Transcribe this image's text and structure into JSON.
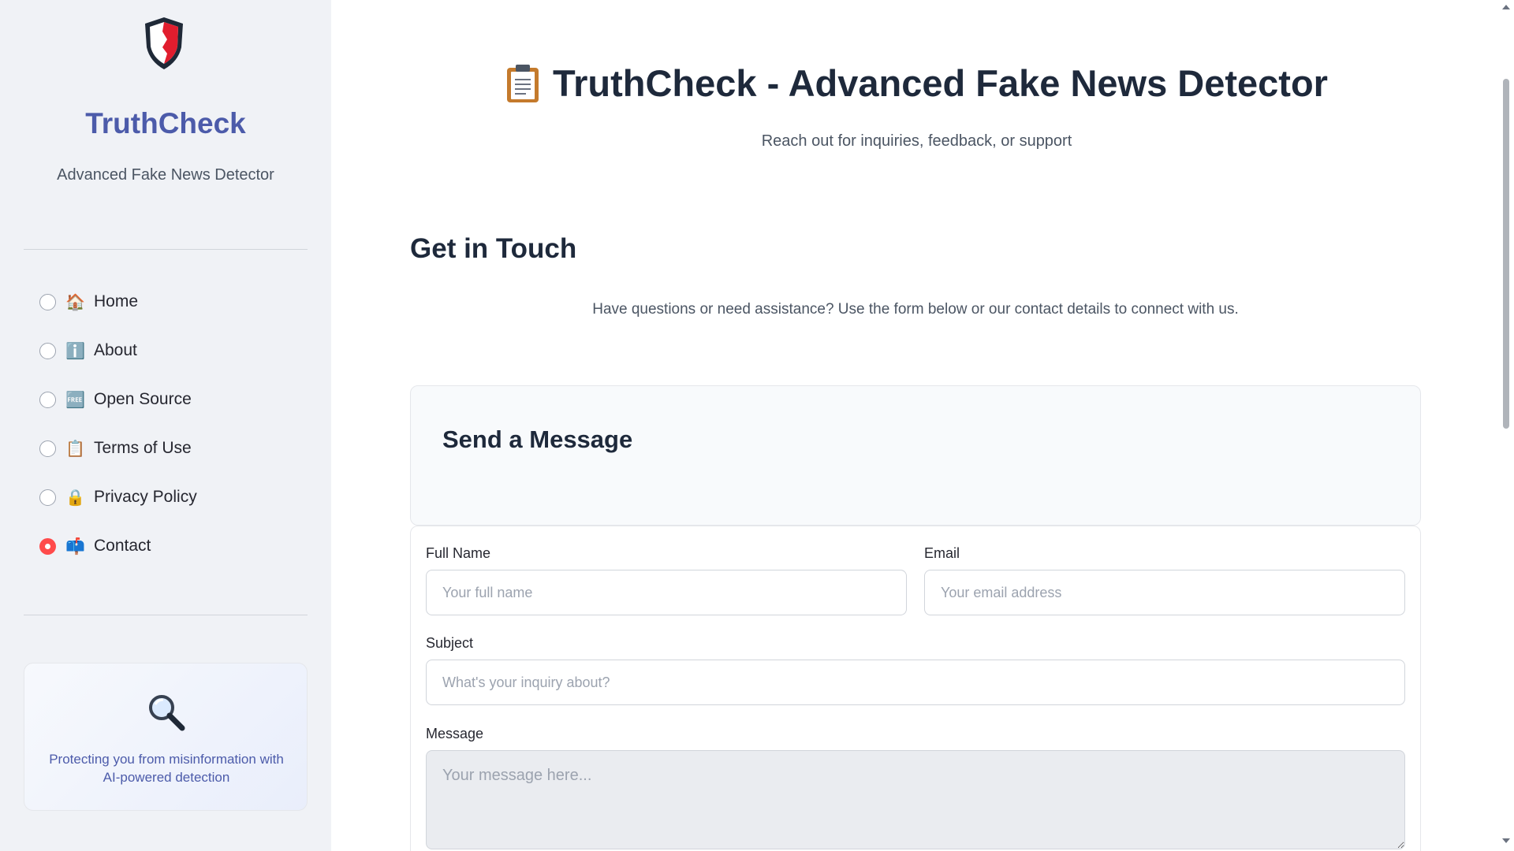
{
  "sidebar": {
    "brand_title": "TruthCheck",
    "brand_subtitle": "Advanced Fake News Detector",
    "nav_items": [
      {
        "icon": "🏠",
        "label": "Home",
        "selected": false
      },
      {
        "icon": "ℹ️",
        "label": "About",
        "selected": false
      },
      {
        "icon": "🆓",
        "label": "Open Source",
        "selected": false
      },
      {
        "icon": "📋",
        "label": "Terms of Use",
        "selected": false
      },
      {
        "icon": "🔒",
        "label": "Privacy Policy",
        "selected": false
      },
      {
        "icon": "📫",
        "label": "Contact",
        "selected": true
      }
    ],
    "info_card_text": "Protecting you from misinformation with AI-powered detection"
  },
  "main": {
    "title": "TruthCheck - Advanced Fake News Detector",
    "subtitle": "Reach out for inquiries, feedback, or support",
    "section_heading": "Get in Touch",
    "section_desc": "Have questions or need assistance? Use the form below or our contact details to connect with us.",
    "card_title": "Send a Message",
    "form": {
      "name_label": "Full Name",
      "name_placeholder": "Your full name",
      "email_label": "Email",
      "email_placeholder": "Your email address",
      "subject_label": "Subject",
      "subject_placeholder": "What's your inquiry about?",
      "message_label": "Message",
      "message_placeholder": "Your message here..."
    }
  },
  "colors": {
    "brand": "#4c5baa",
    "accent": "#ff4b4b",
    "sidebar_bg": "#f0f2f6"
  }
}
